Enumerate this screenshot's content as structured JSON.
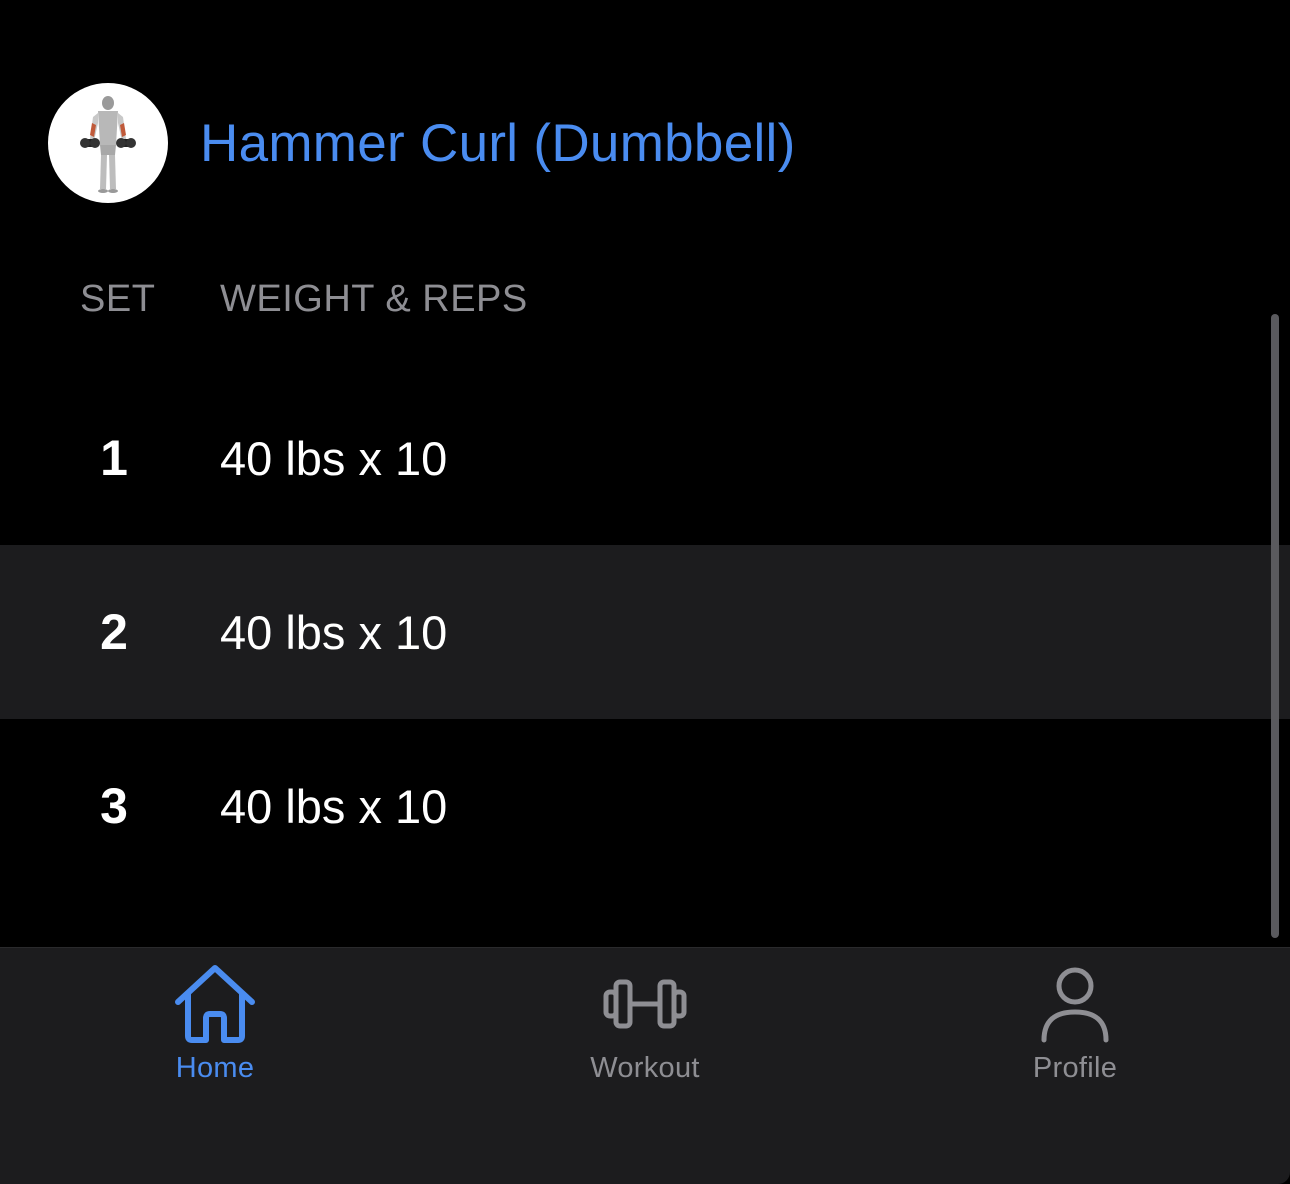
{
  "exercise": {
    "title": "Hammer Curl (Dumbbell)",
    "thumbnail_icon": "exercise-figure-icon"
  },
  "table": {
    "headers": {
      "set": "SET",
      "weight_reps": "WEIGHT & REPS"
    },
    "rows": [
      {
        "set": "1",
        "weight_reps": "40 lbs x 10"
      },
      {
        "set": "2",
        "weight_reps": "40 lbs x 10"
      },
      {
        "set": "3",
        "weight_reps": "40 lbs x 10"
      }
    ]
  },
  "tabbar": {
    "tabs": [
      {
        "label": "Home",
        "icon": "home-icon",
        "active": true
      },
      {
        "label": "Workout",
        "icon": "dumbbell-icon",
        "active": false
      },
      {
        "label": "Profile",
        "icon": "person-icon",
        "active": false
      }
    ]
  },
  "colors": {
    "accent": "#4a8cf0",
    "background": "#000000",
    "row_alt": "#1c1c1e",
    "muted_text": "#8e8e93"
  }
}
